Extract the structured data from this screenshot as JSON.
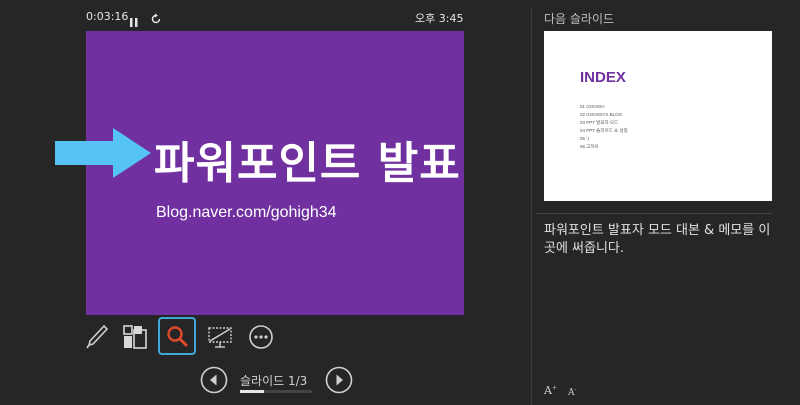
{
  "topbar": {
    "elapsed_time": "0:03:16",
    "clock": "오후 3:45",
    "pause_icon": "pause-icon",
    "reset_icon": "reset-timer-icon"
  },
  "current_slide": {
    "title": "파워포인트 발표",
    "subtitle": "Blog.naver.com/gohigh34",
    "background_color": "#7030a0",
    "pointer_icon": "laser-arrow-icon",
    "pointer_color": "#55c4f5"
  },
  "tools": [
    {
      "name": "pen-icon"
    },
    {
      "name": "see-all-slides-icon"
    },
    {
      "name": "zoom-icon",
      "active": true,
      "color": "#e04a2a"
    },
    {
      "name": "black-screen-icon"
    },
    {
      "name": "more-options-icon"
    }
  ],
  "navigation": {
    "label": "슬라이드",
    "counter": "1/3",
    "progress": 0.333,
    "prev_icon": "previous-slide-icon",
    "next_icon": "next-slide-icon"
  },
  "next_slide": {
    "label": "다음 슬라이드",
    "title": "INDEX",
    "items": [
      "01  GOHIGH",
      "02  GOHIGH'S BLOG",
      "03  PPT 발표자 모드",
      "04  PPT 슬라이드 쇼 설정",
      "05  :)",
      "06  고하이"
    ],
    "title_color": "#7030a0"
  },
  "notes": {
    "text": "파워포인트 발표자 모드 대본 & 메모를 이곳에 써줍니다."
  },
  "font_controls": {
    "increase": "A",
    "decrease": "A"
  }
}
